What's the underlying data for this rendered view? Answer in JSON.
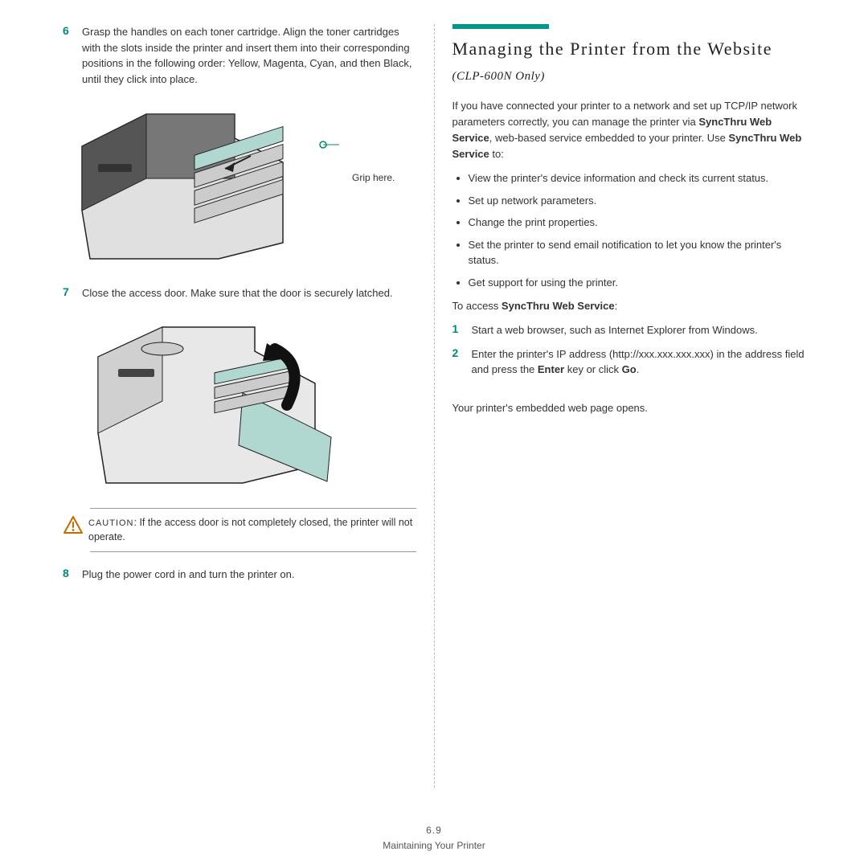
{
  "left": {
    "steps": [
      {
        "num": "6",
        "text": "Grasp the handles on each toner cartridge. Align the toner cartridges with the slots inside the printer and insert them into their corresponding positions in the following order: Yellow, Magenta, Cyan, and then Black, until they click into place."
      },
      {
        "num": "7",
        "text": "Close the access door. Make sure that the door is securely latched."
      },
      {
        "num": "8",
        "text": "Plug the power cord in and turn the printer on."
      }
    ],
    "grip_label": "Grip here.",
    "caution_label": "CAUTION",
    "caution_text": ": If the access door is not completely closed, the printer will not operate."
  },
  "right": {
    "title_main": "Managing the Printer from the Website",
    "title_sub": " (CLP-600N Only)",
    "intro_pre": "If you have connected your printer to a network and set up TCP/IP network parameters correctly, you can manage the printer via ",
    "svc": "SyncThru Web Service",
    "intro_post": ", web-based service embedded to your printer. Use ",
    "intro_tail": " to:",
    "bullets": [
      "View the printer's device information and check its current status.",
      "Set up network parameters.",
      "Change the print properties.",
      "Set the printer to send email notification to let you know the printer's status.",
      "Get support for using the printer."
    ],
    "access_label_pre": "To access ",
    "access_label_post": ":",
    "steps": [
      {
        "num": "1",
        "text": "Start a web browser, such as Internet Explorer from Windows."
      },
      {
        "num": "2",
        "text_pre": "Enter the printer's IP address (http://xxx.xxx.xxx.xxx) in the address field and press the ",
        "key1": "Enter",
        "mid": " key or click ",
        "key2": "Go",
        "text_post": "."
      }
    ],
    "closing": "Your printer's embedded web page opens."
  },
  "footer": {
    "page": "6.9",
    "section": "Maintaining Your Printer"
  }
}
